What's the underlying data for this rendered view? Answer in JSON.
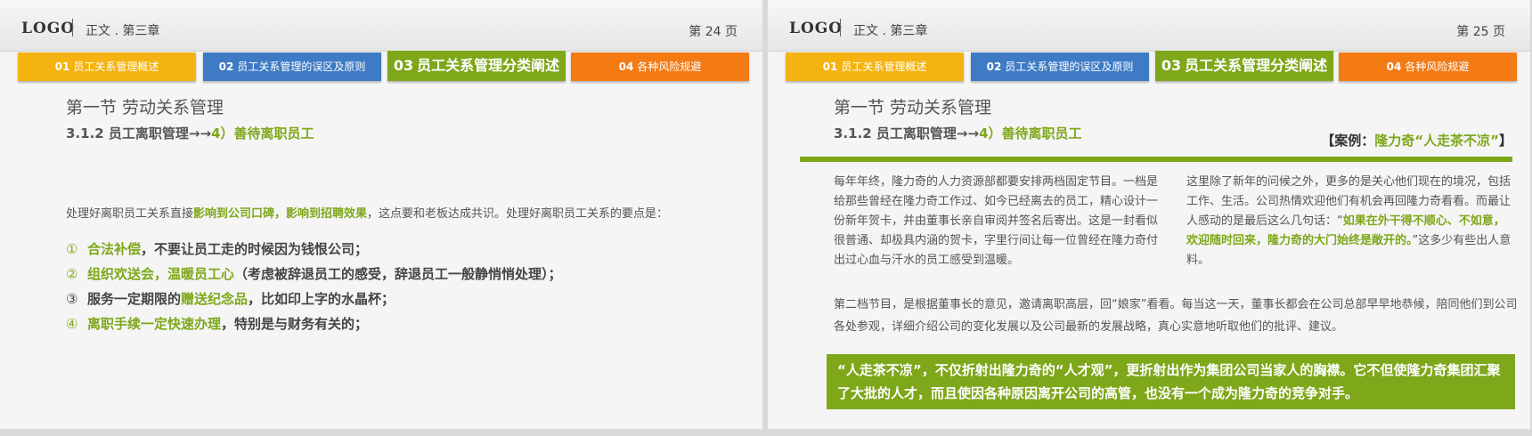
{
  "left": {
    "logo": "LOGO",
    "section": "正文 . 第三章",
    "page": "第 24 页",
    "tabs": [
      {
        "num": "01",
        "label": "员工关系管理概述"
      },
      {
        "num": "02",
        "label": "员工关系管理的误区及原则"
      },
      {
        "num": "03",
        "label": "员工关系管理分类阐述"
      },
      {
        "num": "04",
        "label": "各种风险规避"
      }
    ],
    "title": "第一节  劳动关系管理",
    "subtitle_main": "3.1.2 员工离职管理→→",
    "subtitle_hl": "4）善待离职员工",
    "intro_a": "处理好离职员工关系直接",
    "intro_hl": "影响到公司口碑，影响到招聘效果",
    "intro_b": "，这点要和老板达成共识。处理好离职员工关系的要点是：",
    "items": [
      {
        "num": "①",
        "hl": "合法补偿",
        "rest": "，不要让员工走的时候因为钱恨公司；"
      },
      {
        "num": "②",
        "hl": "组织欢送会，温暖员工心",
        "rest": "（考虑被辞退员工的感受，辞退员工一般静悄悄处理）；"
      },
      {
        "num": "③",
        "pre": "服务一定期限的",
        "hl": "赠送纪念品",
        "rest": "，比如印上字的水晶杯；"
      },
      {
        "num": "④",
        "hl": "离职手续一定快速办理",
        "rest": "，特别是与财务有关的；"
      }
    ]
  },
  "right": {
    "logo": "LOGO",
    "section": "正文 . 第三章",
    "page": "第 25 页",
    "tabs": [
      {
        "num": "01",
        "label": "员工关系管理概述"
      },
      {
        "num": "02",
        "label": "员工关系管理的误区及原则"
      },
      {
        "num": "03",
        "label": "员工关系管理分类阐述"
      },
      {
        "num": "04",
        "label": "各种风险规避"
      }
    ],
    "title": "第一节  劳动关系管理",
    "subtitle_main": "3.1.2 员工离职管理→→",
    "subtitle_hl": "4）善待离职员工",
    "case_a": "【案例：",
    "case_hl": "隆力奇“人走茶不凉”",
    "case_b": "】",
    "col1": "每年年终，隆力奇的人力资源部都要安排两档固定节目。一档是给那些曾经在隆力奇工作过、如今已经离去的员工，精心设计一份新年贺卡，并由董事长亲自审阅并签名后寄出。这是一封看似很普通、却极具内涵的贺卡，字里行间让每一位曾经在隆力奇付出过心血与汗水的员工感受到温暖。",
    "col2_a": "这里除了新年的问候之外，更多的是关心他们现在的境况，包括工作、生活。公司热情欢迎他们有机会再回隆力奇看看。而最让人感动的是最后这么几句话：“",
    "col2_hl": "如果在外干得不顺心、不如意，欢迎随时回来，隆力奇的大门始终是敞开的。",
    "col2_b": "”这多少有些出人意料。",
    "para2": "第二档节目，是根据董事长的意见，邀请离职高层，回“娘家”看看。每当这一天，董事长都会在公司总部早早地恭候，陪同他们到公司各处参观，详细介绍公司的变化发展以及公司最新的发展战略，真心实意地听取他们的批评、建议。",
    "banner": "“人走茶不凉”，不仅折射出隆力奇的“人才观”，更折射出作为集团公司当家人的胸襟。它不但使隆力奇集团汇聚了大批的人才，而且使因各种原因离开公司的高管，也没有一个成为隆力奇的竞争对手。"
  }
}
